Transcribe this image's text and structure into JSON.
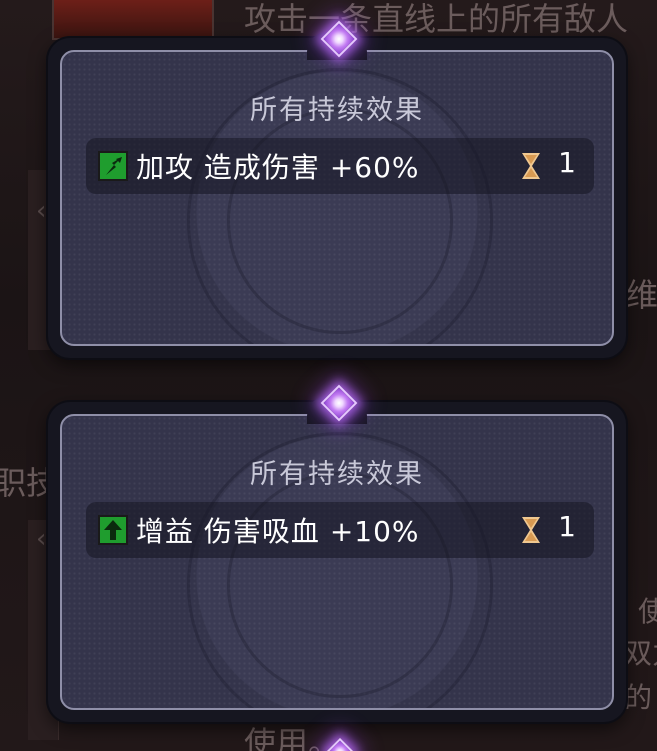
{
  "background": {
    "top_text": "攻击一条直线上的所有敌人",
    "left_text": "职技",
    "right_text_1": "维",
    "right_text_2": "使",
    "right_text_3": "双力",
    "right_text_4": "的",
    "bottom_text": "使用。"
  },
  "popups": [
    {
      "title": "所有持续效果",
      "effect": {
        "icon": "attack-up-icon",
        "icon_color": "#1f9d2e",
        "name": "加攻",
        "description": "造成伤害 +60%",
        "turns": "1"
      }
    },
    {
      "title": "所有持续效果",
      "effect": {
        "icon": "buff-up-arrow-icon",
        "icon_color": "#1f9d2e",
        "name": "增益",
        "description": "伤害吸血 +10%",
        "turns": "1"
      }
    }
  ],
  "colors": {
    "gem": "#c27bf2",
    "panel": "#34344b",
    "hourglass": "#f0c890"
  }
}
